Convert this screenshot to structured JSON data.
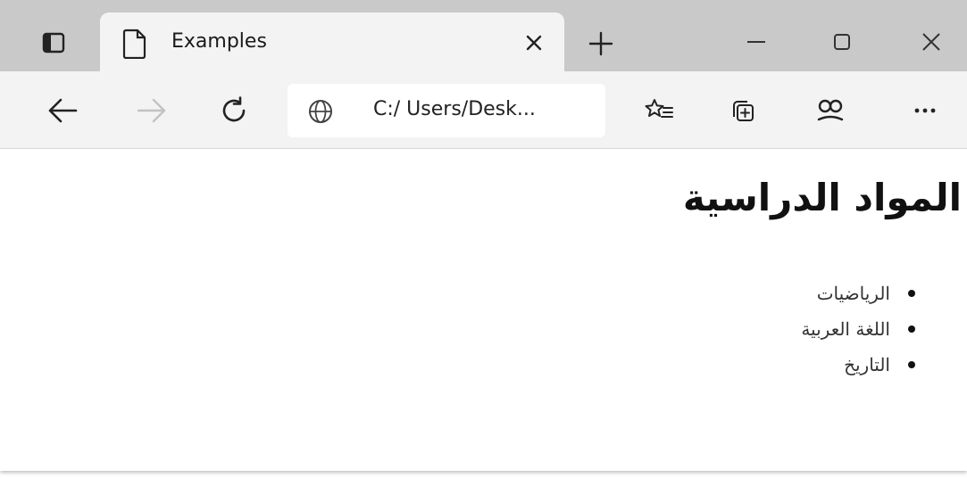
{
  "browser": {
    "tab": {
      "title": "Examples"
    },
    "address_bar": {
      "url": "C:/ Users/Desk..."
    },
    "icons": {
      "tab_actions": "tab-actions-icon",
      "document": "document-icon",
      "close_tab": "close-icon",
      "new_tab": "plus-icon",
      "minimize": "minimize-icon",
      "maximize": "maximize-icon",
      "close_window": "close-icon",
      "back": "arrow-left-icon",
      "forward": "arrow-right-icon",
      "refresh": "refresh-icon",
      "site_info": "globe-icon",
      "favorites": "favorites-icon",
      "collections": "collections-icon",
      "profile": "profile-icon",
      "more": "more-icon"
    },
    "colors": {
      "tabstrip": "#c9c9c9",
      "toolbar": "#f3f3f3",
      "content": "#ffffff"
    }
  },
  "page": {
    "heading": "المواد الدراسية",
    "subjects": [
      "الرياضيات",
      "اللغة العربية",
      "التاريخ"
    ]
  }
}
